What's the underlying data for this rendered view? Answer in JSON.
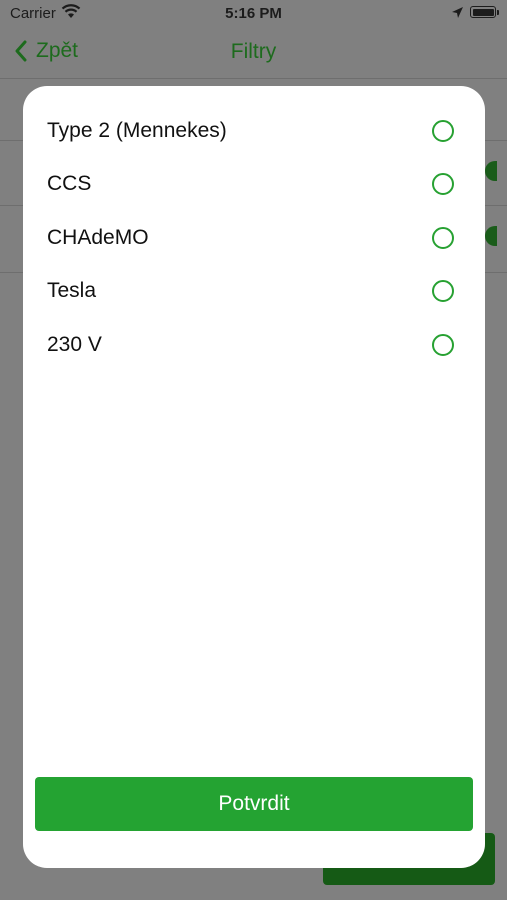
{
  "status_bar": {
    "carrier": "Carrier",
    "time": "5:16 PM",
    "icons": [
      "wifi-icon",
      "location-arrow-icon",
      "battery-icon"
    ]
  },
  "navbar": {
    "back_label": "Zpět",
    "title": "Filtry"
  },
  "modal": {
    "options": [
      {
        "label": "Type 2 (Mennekes)",
        "selected": false
      },
      {
        "label": "CCS",
        "selected": false
      },
      {
        "label": "CHAdeMO",
        "selected": false
      },
      {
        "label": "Tesla",
        "selected": false
      },
      {
        "label": "230 V",
        "selected": false
      }
    ],
    "confirm_label": "Potvrdit"
  },
  "colors": {
    "accent_green": "#24a332",
    "nav_green_dimmed": "#1d6b1d",
    "overlay_gray": "#808080"
  }
}
